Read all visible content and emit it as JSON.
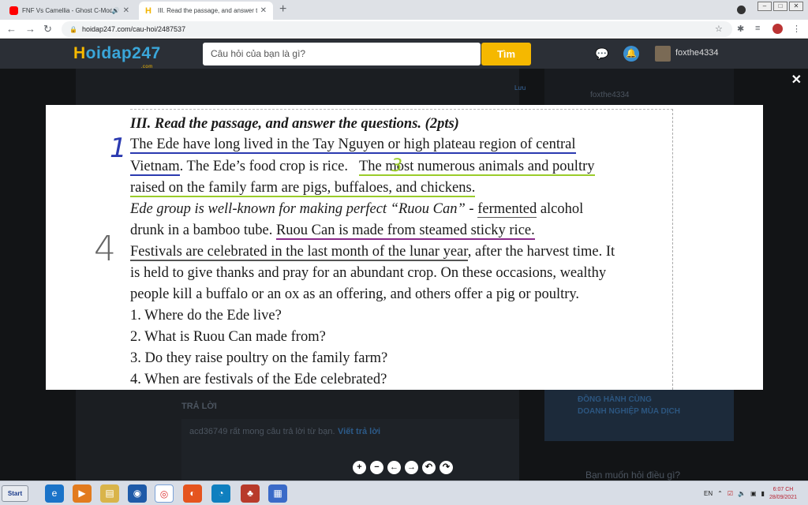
{
  "browser": {
    "tabs": [
      {
        "title": "FNF Vs Camellia - Ghost C-Mod",
        "icon": "youtube-icon",
        "audio": true
      },
      {
        "title": "III. Read the passage, and answer t",
        "icon": "hoidap-icon",
        "active": true
      }
    ],
    "url": "hoidap247.com/cau-hoi/2487537"
  },
  "site": {
    "logo_h": "H",
    "logo_rest": "oidap247",
    "logo_sub": ".com",
    "search_placeholder": "Câu hỏi của bạn là gì?",
    "search_button": "Tìm",
    "username": "foxthe4334"
  },
  "background": {
    "luu": "Lưu",
    "right_username": "foxthe4334",
    "tra_loi": "TRẢ LỜI",
    "request_text": "acd36749 rất mong câu trả lời từ bạn.",
    "request_link": "Viết trả lời",
    "banner_line1": "ĐỒNG HÀNH CÙNG",
    "banner_line2": "DOANH NGHIỆP MÙA DỊCH",
    "ask_prompt": "Bạn muốn hỏi điều gì?"
  },
  "worksheet": {
    "heading": "III. Read the passage, and answer the questions. (2pts)",
    "l1": "The Ede have long lived in the Tay Nguyen or high plateau region of central",
    "l2a": "Vietnam",
    "l2b": ". The Ede’s food crop is rice.",
    "l2c": "The most numerous animals and poultry",
    "l3": "raised on the family farm are pigs, buffaloes, and chickens.",
    "l4a": "Ede group is well-known for making perfect “Ruou Can” - ",
    "l4b": "fermented",
    "l4c": " alcohol",
    "l5a": "drunk in a bamboo tube. ",
    "l5b": "Ruou Can is made from steamed sticky rice.",
    "l6a": "Festivals are celebrated in the last month of the lunar year",
    "l6b": ", after the harvest time. It",
    "l7": "is held to give thanks and pray for an abundant crop. On these occasions, wealthy",
    "l8": "people kill a buffalo or an ox as an offering, and others offer a pig or poultry.",
    "q1": "1. Where do the Ede live?",
    "q2": "2. What is Ruou Can made from?",
    "q3": "3. Do they raise poultry on the family farm?",
    "q4": "4. When are festivals of the Ede celebrated?",
    "handwritten": [
      "1",
      "3",
      "4"
    ]
  },
  "taskbar": {
    "start": "Start",
    "lang": "EN",
    "time": "6:07 CH",
    "date": "28/09/2021"
  }
}
